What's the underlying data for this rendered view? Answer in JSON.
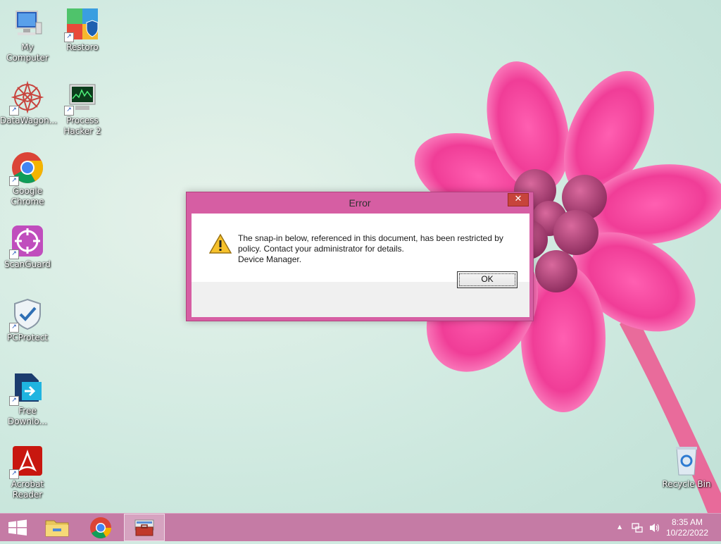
{
  "desktop": {
    "icons": [
      {
        "label": "My Computer",
        "icon": "computer-icon"
      },
      {
        "label": "Restoro",
        "icon": "restoro-icon"
      },
      {
        "label": "DataWagon...",
        "icon": "datawagon-icon"
      },
      {
        "label": "Process Hacker 2",
        "icon": "process-hacker-icon"
      },
      {
        "label": "Google Chrome",
        "icon": "chrome-icon"
      },
      {
        "label": "ScanGuard",
        "icon": "scanguard-icon"
      },
      {
        "label": "PCProtect",
        "icon": "pcprotect-icon"
      },
      {
        "label": "Free Downlo...",
        "icon": "free-download-icon"
      },
      {
        "label": "Acrobat Reader",
        "icon": "acrobat-icon"
      },
      {
        "label": "Recycle Bin",
        "icon": "recycle-bin-icon"
      }
    ]
  },
  "dialog": {
    "title": "Error",
    "close_glyph": "✕",
    "message_line1": "The snap-in below, referenced in this document, has been restricted by",
    "message_line2": "policy. Contact your administrator for details.",
    "message_line3": "Device Manager.",
    "ok_label": "OK",
    "icon": "warning-icon"
  },
  "taskbar": {
    "start_icon": "windows-start-icon",
    "pinned": [
      "file-explorer-icon",
      "chrome-icon",
      "toolbox-icon"
    ],
    "tray": {
      "up_arrow": "▲",
      "clock_time": "8:35 AM",
      "clock_date": "10/22/2022"
    }
  },
  "colors": {
    "accent": "#d65ea3",
    "taskbar": "#c57ba5",
    "close": "#c7443b"
  }
}
